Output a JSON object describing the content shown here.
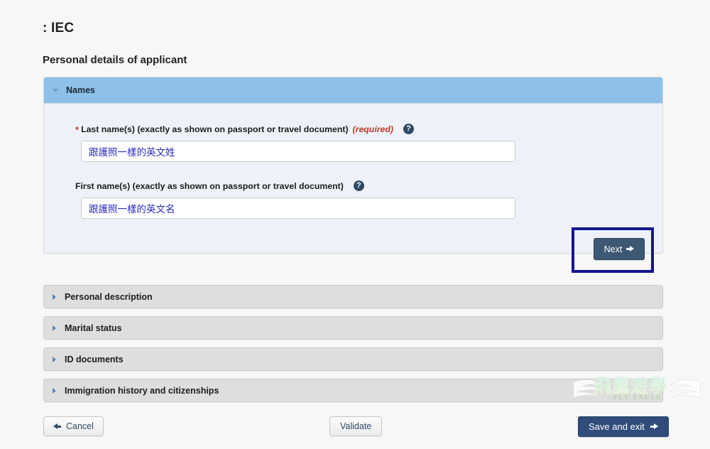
{
  "header": {
    "app_title": ": IEC",
    "page_title": "Personal details of applicant"
  },
  "accordion": {
    "open_section": {
      "title": "Names",
      "caret_icon": "chevron-down-icon",
      "fields": [
        {
          "required_star": "*",
          "label": "Last name(s) (exactly as shown on passport or travel document)",
          "required_tag": "(required)",
          "help_icon": "help-circle-icon",
          "value": "跟護照一樣的英文姓",
          "placeholder": ""
        },
        {
          "required_star": "",
          "label": "First name(s) (exactly as shown on passport or travel document)",
          "required_tag": "",
          "help_icon": "help-circle-icon",
          "value": "跟護照一樣的英文名",
          "placeholder": ""
        }
      ],
      "next_button": "Next"
    },
    "closed_sections": [
      {
        "title": "Personal description",
        "caret_icon": "chevron-right-icon"
      },
      {
        "title": "Marital status",
        "caret_icon": "chevron-right-icon"
      },
      {
        "title": "ID documents",
        "caret_icon": "chevron-right-icon"
      },
      {
        "title": "Immigration history and citizenships",
        "caret_icon": "chevron-right-icon"
      }
    ]
  },
  "footer": {
    "cancel_label": "Cancel",
    "validate_label": "Validate",
    "save_exit_label": "Save and exit"
  },
  "watermark": {
    "main": "飛鷹遊學",
    "sub": "FLY EAGLE"
  },
  "colors": {
    "page_background": "#f7f7f7",
    "open_header": "#8fc0e8",
    "open_body": "#eef2f8",
    "closed_header": "#dedede",
    "primary_button": "#2f4c7a",
    "next_button": "#3d5872",
    "highlight_outline": "#14168f",
    "required_red": "#c0392b",
    "input_text": "#2b2bbd"
  }
}
